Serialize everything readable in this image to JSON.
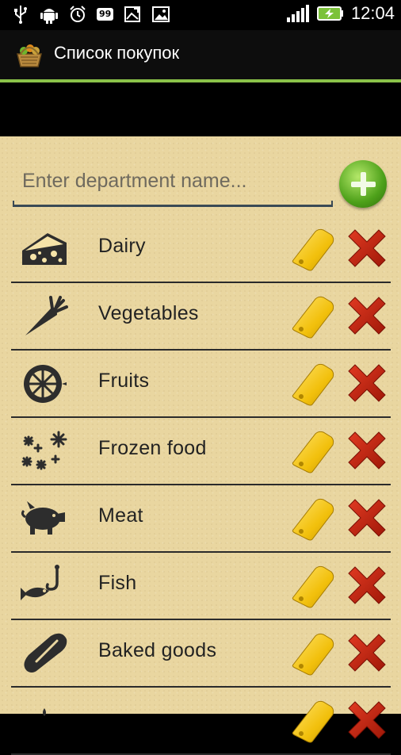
{
  "status_bar": {
    "battery_badge": "99",
    "time": "12:04",
    "icons": [
      "usb-icon",
      "android-debug-icon",
      "alarm-icon",
      "battery-level-badge",
      "gallery-icon",
      "image-icon",
      "signal-icon",
      "battery-charging-icon"
    ]
  },
  "action_bar": {
    "title": "Список покупок",
    "app_icon": "basket-icon",
    "accent_color": "#8bc34a"
  },
  "department_input": {
    "placeholder": "Enter department name...",
    "value": ""
  },
  "add_button": {
    "icon": "plus-icon",
    "color": "#4ea11a"
  },
  "departments": [
    {
      "label": "Dairy",
      "icon": "cheese-icon"
    },
    {
      "label": "Vegetables",
      "icon": "carrot-icon"
    },
    {
      "label": "Fruits",
      "icon": "lemon-slice-icon"
    },
    {
      "label": "Frozen food",
      "icon": "snowflakes-icon"
    },
    {
      "label": "Meat",
      "icon": "pig-icon"
    },
    {
      "label": "Fish",
      "icon": "fish-hook-icon"
    },
    {
      "label": "Baked goods",
      "icon": "bread-icon"
    }
  ],
  "row_actions": {
    "edit_icon": "tag-edit-icon",
    "delete_icon": "delete-x-icon",
    "edit_color": "#f0c20a",
    "delete_color": "#c8200f"
  }
}
